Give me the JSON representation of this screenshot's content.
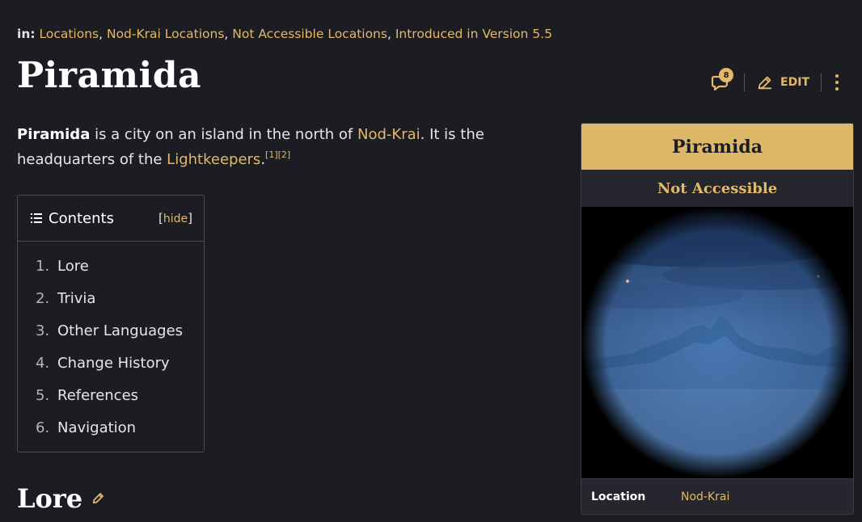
{
  "categories": {
    "label": "in:",
    "items": [
      "Locations",
      "Nod-Krai Locations",
      "Not Accessible Locations",
      "Introduced in Version 5.5"
    ]
  },
  "page_title": "Piramida",
  "actions": {
    "comment_count": "8",
    "edit_label": "EDIT"
  },
  "intro": {
    "subject": "Piramida",
    "text1": " is a city on an island in the north of ",
    "link1": "Nod-Krai",
    "text2": ". It is the headquarters of the ",
    "link2": "Lightkeepers",
    "text3": ".",
    "refs": "[1][2]"
  },
  "toc": {
    "title": "Contents",
    "hide_label": "hide",
    "items": [
      {
        "num": "1.",
        "label": "Lore"
      },
      {
        "num": "2.",
        "label": "Trivia"
      },
      {
        "num": "3.",
        "label": "Other Languages"
      },
      {
        "num": "4.",
        "label": "Change History"
      },
      {
        "num": "5.",
        "label": "References"
      },
      {
        "num": "6.",
        "label": "Navigation"
      }
    ]
  },
  "section_heading": "Lore",
  "infobox": {
    "title": "Piramida",
    "subtitle": "Not Accessible",
    "rows": [
      {
        "key": "Location",
        "value": "Nod-Krai"
      }
    ]
  },
  "colors": {
    "accent": "#e2b86a",
    "background": "#1c1d22",
    "infobox_header": "#dfb768"
  }
}
